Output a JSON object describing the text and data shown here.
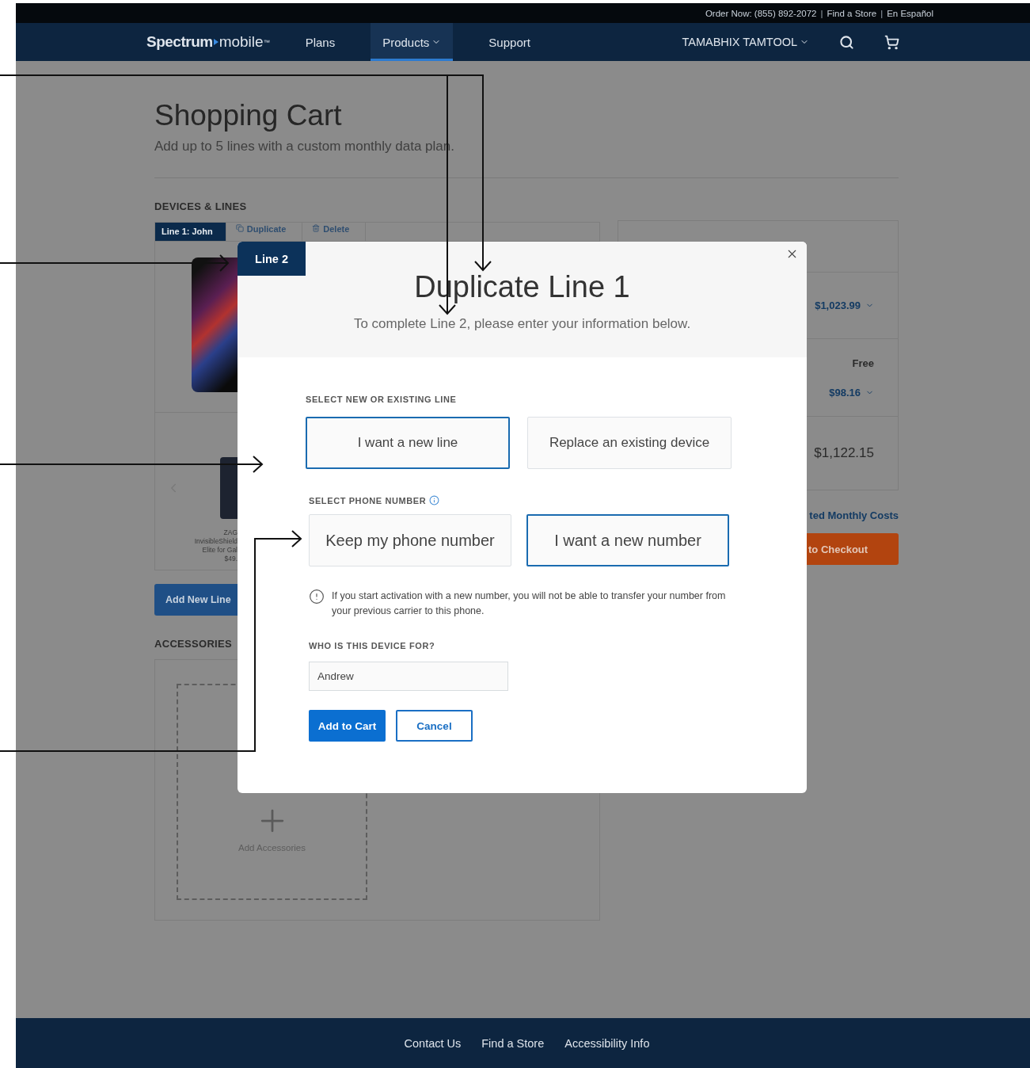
{
  "top_bar": {
    "separator": "|",
    "links": [
      "Order Now: (855) 892-2072",
      "Find a Store",
      "En Español"
    ]
  },
  "nav": {
    "logo": {
      "brand": "Spectrum",
      "product": "mobile",
      "mark": "™"
    },
    "links": [
      {
        "label": "Plans",
        "selected": false,
        "has_menu": false
      },
      {
        "label": "Products",
        "selected": true,
        "has_menu": true
      },
      {
        "label": "Support",
        "selected": false,
        "has_menu": false
      }
    ],
    "account": {
      "label": "TAMABHIX TAMTOOL",
      "has_menu": true
    }
  },
  "cart": {
    "title": "Shopping Cart",
    "subtitle": "Add up to 5 lines with a custom monthly data plan.",
    "devices_heading": "DEVICES & LINES",
    "line_tabs": [
      {
        "label": "Line 1: John",
        "kind": "line",
        "selected": true
      },
      {
        "label": "Duplicate",
        "kind": "duplicate",
        "selected": false
      },
      {
        "label": "Delete",
        "kind": "delete",
        "selected": false
      }
    ],
    "accessory_preview": {
      "brand": "ZAG",
      "name": "InvisibleShield",
      "detail": "Elite for Gal",
      "price": "$49."
    },
    "add_line_button": "Add New Line",
    "accessories_heading": "ACCESSORIES",
    "add_accessories": "Add Accessories"
  },
  "summary": {
    "rows": [
      {
        "value": "$1,023.99",
        "expandable": true
      },
      {
        "value": "Free",
        "expandable": false
      },
      {
        "value": "$98.16",
        "expandable": true
      }
    ],
    "total": "$1,122.15",
    "monthly_link": "ted Monthly Costs",
    "checkout_button": "to Checkout"
  },
  "modal": {
    "line_tag": "Line 2",
    "title": "Duplicate Line 1",
    "subtitle": "To complete Line 2, please enter your information below.",
    "sections": [
      {
        "kind": "choice",
        "label": "SELECT NEW OR EXISTING LINE",
        "info": false,
        "options": [
          {
            "label": "I want a new line",
            "selected": true
          },
          {
            "label": "Replace an existing device",
            "selected": false
          }
        ]
      },
      {
        "kind": "choice",
        "label": "SELECT PHONE NUMBER",
        "info": true,
        "options": [
          {
            "label": "Keep my phone number",
            "selected": false
          },
          {
            "label": "I want a new number",
            "selected": true
          }
        ],
        "notice": "If you start activation with a new number, you will not be able to transfer your number from your previous carrier to this phone."
      },
      {
        "kind": "text",
        "label": "WHO IS THIS DEVICE FOR?",
        "info": false,
        "value": "Andrew"
      }
    ],
    "buttons": [
      {
        "label": "Add to Cart",
        "kind": "primary"
      },
      {
        "label": "Cancel",
        "kind": "secondary"
      }
    ]
  },
  "footer": {
    "links": [
      "Contact Us",
      "Find a Store",
      "Accessibility Info"
    ]
  }
}
